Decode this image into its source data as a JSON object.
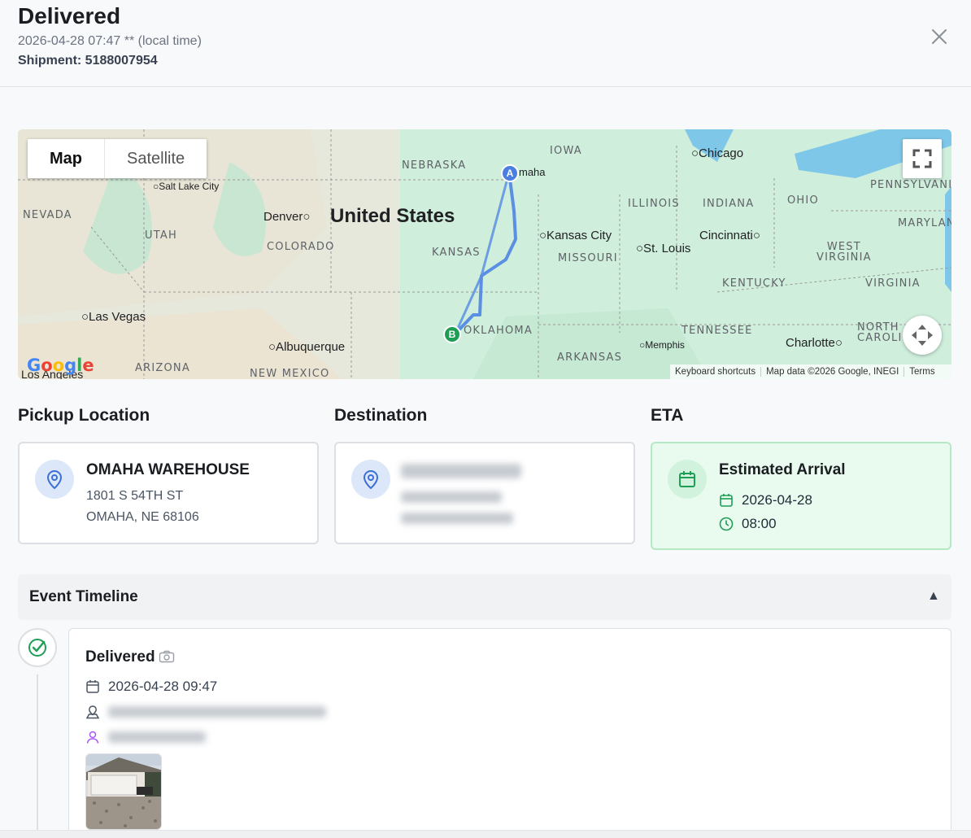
{
  "header": {
    "title": "Delivered",
    "timestamp": "2026-04-28 07:47 ** (local time)",
    "shipment": "Shipment: 5188007954",
    "close_icon": "close-icon"
  },
  "map": {
    "toggle": {
      "map_label": "Map",
      "satellite_label": "Satellite",
      "selected": "Map"
    },
    "country_label": "United States",
    "states": [
      "NEBRASKA",
      "IOWA",
      "NEVADA",
      "UTAH",
      "COLORADO",
      "KANSAS",
      "MISSOURI",
      "ILLINOIS",
      "INDIANA",
      "OHIO",
      "PENNSYLVANIA",
      "MARYLAND",
      "WEST VIRGINIA",
      "VIRGINIA",
      "KENTUCKY",
      "TENNESSEE",
      "NORTH CAROLINA",
      "ARKANSAS",
      "OKLAHOMA",
      "ARIZONA",
      "NEW MEXICO"
    ],
    "cities": [
      "Salt Lake City",
      "Denver",
      "Omaha",
      "Chicago",
      "Kansas City",
      "St. Louis",
      "Cincinnati",
      "Las Vegas",
      "Albuquerque",
      "Memphis",
      "Charlotte",
      "Los Angeles"
    ],
    "marker_a": "A",
    "marker_b": "B",
    "google_logo": "Google",
    "footer": {
      "shortcuts": "Keyboard shortcuts",
      "attribution": "Map data ©2026 Google, INEGI",
      "terms": "Terms"
    },
    "route_color": "#5b8fe3"
  },
  "pickup": {
    "heading": "Pickup Location",
    "name": "OMAHA WAREHOUSE",
    "address_line1": "1801 S 54TH ST",
    "address_line2": "OMAHA, NE 68106",
    "icon": "map-pin-icon"
  },
  "destination": {
    "heading": "Destination",
    "icon": "map-pin-icon"
  },
  "eta": {
    "heading": "ETA",
    "title": "Estimated Arrival",
    "date": "2026-04-28",
    "time": "08:00",
    "accent": "#1e9e55"
  },
  "timeline": {
    "heading": "Event Timeline",
    "collapse_icon": "▲",
    "events": [
      {
        "status": "Delivered",
        "datetime": "2026-04-28 09:47"
      }
    ]
  }
}
